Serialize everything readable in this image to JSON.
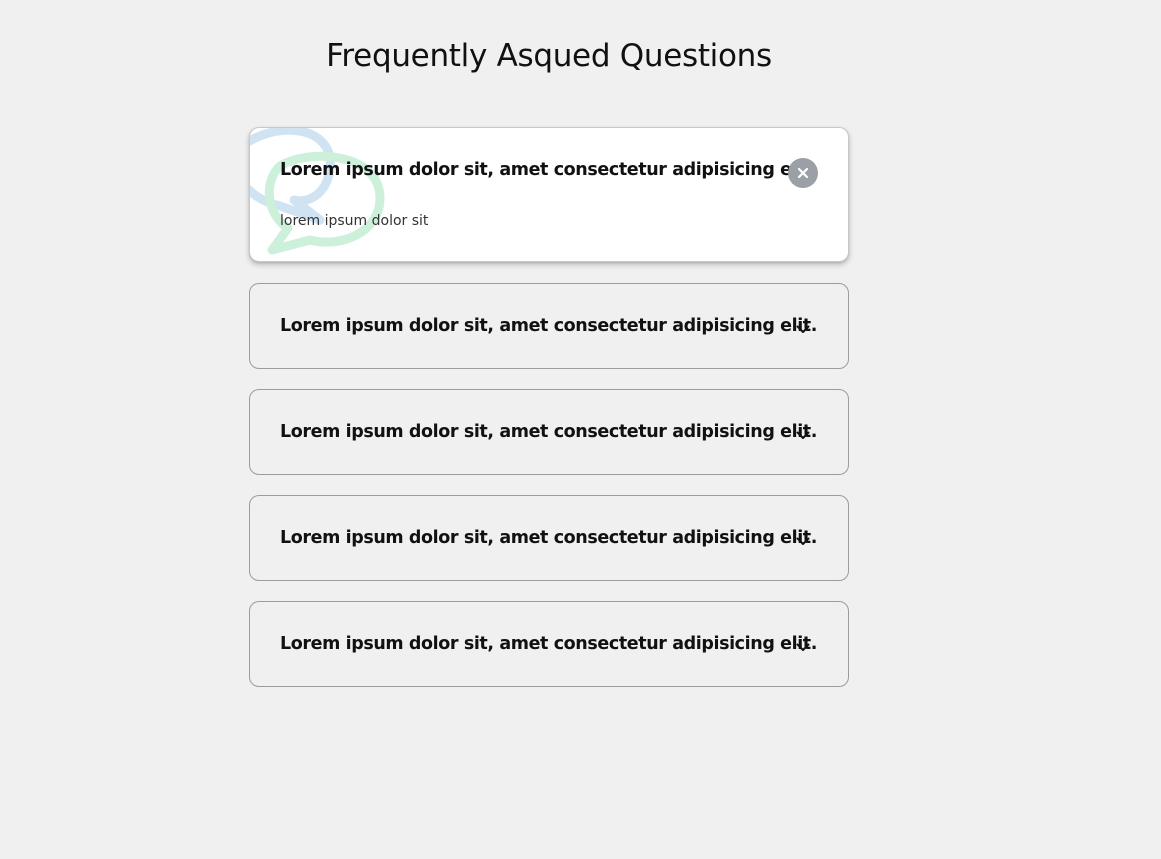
{
  "page": {
    "title": "Frequently Asqued Questions"
  },
  "faqs": [
    {
      "question": "Lorem ipsum dolor sit, amet consectetur adipisicing elit.",
      "answer": "lorem ipsum dolor sit",
      "expanded": true,
      "toggle_icon": "close-icon"
    },
    {
      "question": "Lorem ipsum dolor sit, amet consectetur adipisicing elit.",
      "expanded": false,
      "toggle_icon": "chevron-down-icon"
    },
    {
      "question": "Lorem ipsum dolor sit, amet consectetur adipisicing elit.",
      "expanded": false,
      "toggle_icon": "chevron-down-icon"
    },
    {
      "question": "Lorem ipsum dolor sit, amet consectetur adipisicing elit.",
      "expanded": false,
      "toggle_icon": "chevron-down-icon"
    },
    {
      "question": "Lorem ipsum dolor sit, amet consectetur adipisicing elit.",
      "expanded": false,
      "toggle_icon": "chevron-down-icon"
    }
  ],
  "colors": {
    "background": "#f0f0f0",
    "card_active": "#ffffff",
    "card_border": "#9c9c9c",
    "close_button": "#9aa0a6",
    "bubble_blue": "#cfe3f3",
    "bubble_green": "#cdf0da"
  }
}
